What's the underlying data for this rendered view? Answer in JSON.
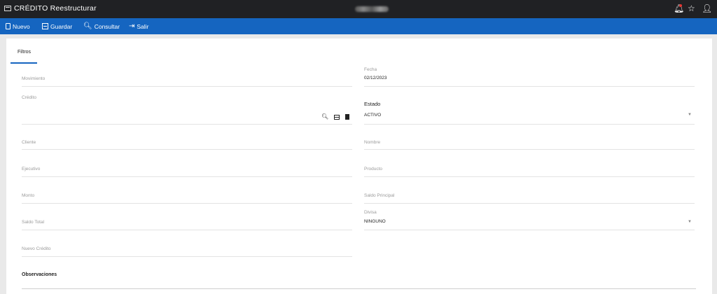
{
  "titlebar": {
    "title": "CRÉDITO Reestructurar",
    "icons": [
      "window-icon",
      "bell-icon",
      "star-icon",
      "user-icon"
    ]
  },
  "toolbar": {
    "nuevo": "Nuevo",
    "guardar": "Guardar",
    "consultar": "Consultar",
    "salir": "Salir"
  },
  "tabs": {
    "filtros": "Filtros"
  },
  "fields": {
    "movimiento": {
      "label": "Movimiento"
    },
    "credito": {
      "label": "Crédito"
    },
    "cliente": {
      "label": "Cliente"
    },
    "ejecutivo": {
      "label": "Ejecutivo"
    },
    "monto": {
      "label": "Monto"
    },
    "saldo_total": {
      "label": "Saldo Total"
    },
    "nuevo_credito": {
      "label": "Nuevo Crédito"
    },
    "fecha": {
      "label": "Fecha",
      "value": "02/12/2023"
    },
    "estado": {
      "title": "Estado",
      "value": "ACTIVO"
    },
    "nombre": {
      "label": "Nombre"
    },
    "producto": {
      "label": "Producto"
    },
    "saldo_principal": {
      "label": "Saldo Principal"
    },
    "divisa": {
      "label": "Divisa",
      "value": "NINGUNO"
    },
    "observaciones": {
      "title": "Observaciones"
    }
  },
  "colors": {
    "toolbar": "#1565c0",
    "titlebar": "#202124",
    "tab_indicator": "#1565c0"
  }
}
